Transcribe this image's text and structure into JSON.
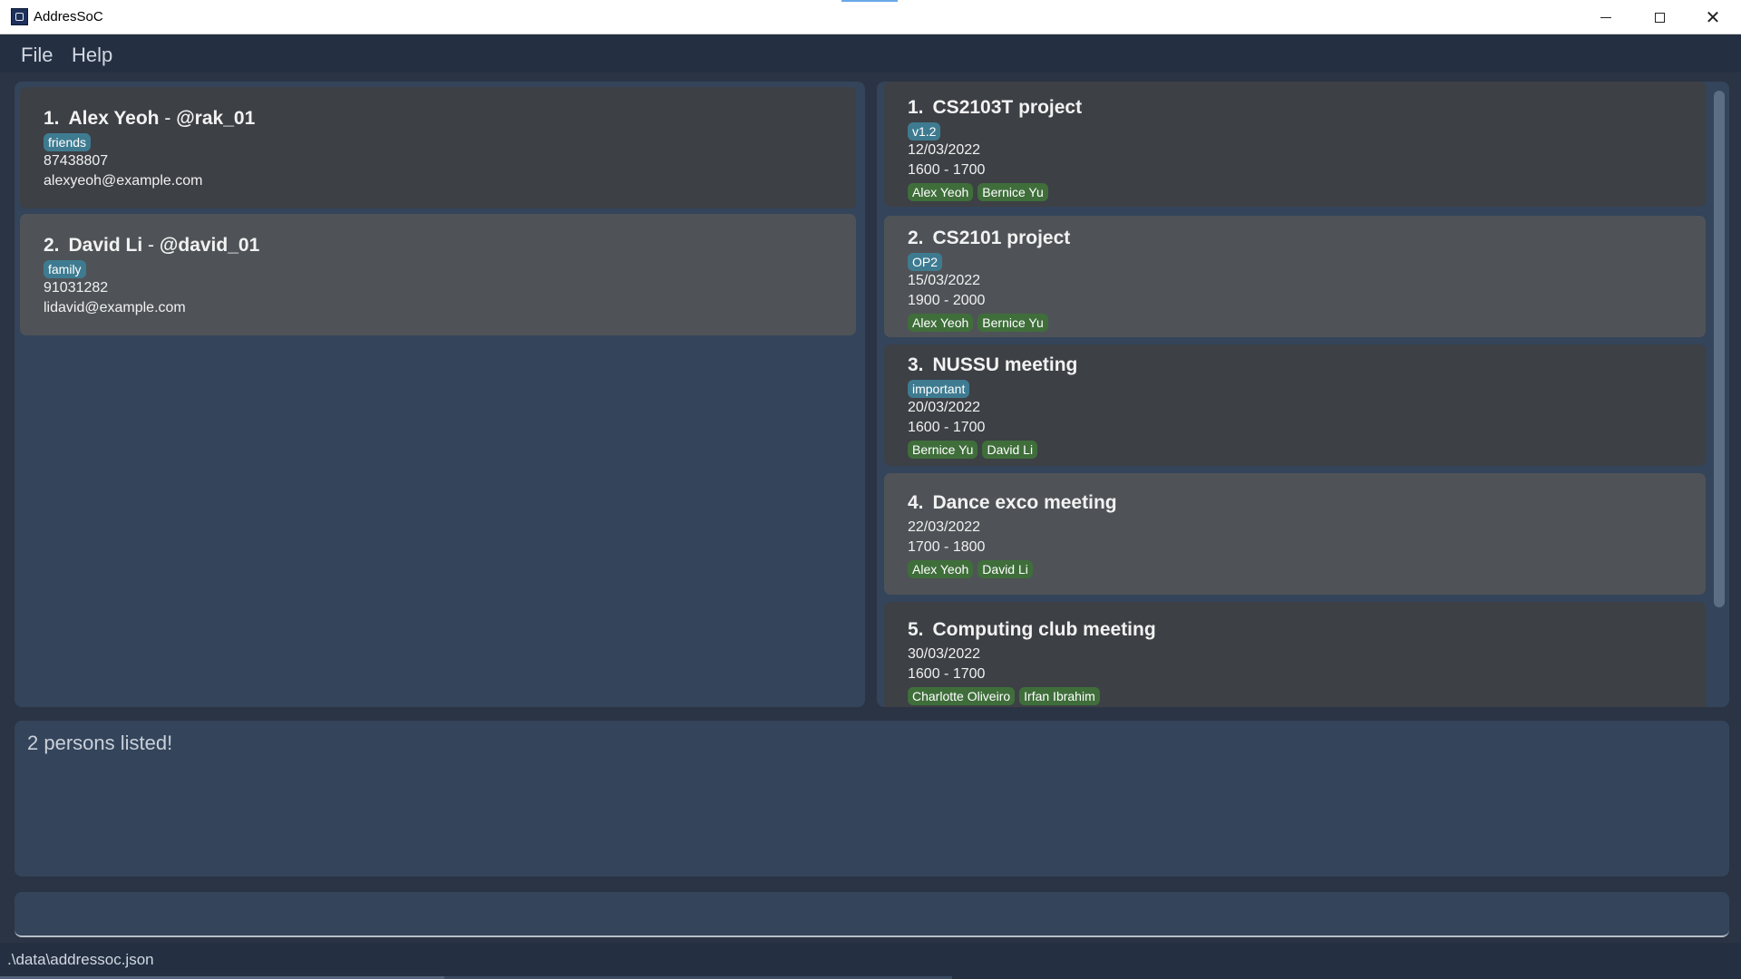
{
  "window": {
    "title": "AddresSoC"
  },
  "menu": {
    "file": "File",
    "help": "Help"
  },
  "persons": [
    {
      "index": "1.",
      "name": "Alex Yeoh",
      "separator": "-",
      "handle": "@rak_01",
      "tags": [
        "friends"
      ],
      "phone": "87438807",
      "email": "alexyeoh@example.com"
    },
    {
      "index": "2.",
      "name": "David Li",
      "separator": "-",
      "handle": "@david_01",
      "tags": [
        "family"
      ],
      "phone": "91031282",
      "email": "lidavid@example.com"
    }
  ],
  "events": [
    {
      "index": "1.",
      "name": "CS2103T project",
      "tags": [
        "v1.2"
      ],
      "date": "12/03/2022",
      "time": "1600 - 1700",
      "participants": [
        "Alex Yeoh",
        "Bernice Yu"
      ]
    },
    {
      "index": "2.",
      "name": "CS2101 project",
      "tags": [
        "OP2"
      ],
      "date": "15/03/2022",
      "time": "1900 - 2000",
      "participants": [
        "Alex Yeoh",
        "Bernice Yu"
      ]
    },
    {
      "index": "3.",
      "name": "NUSSU meeting",
      "tags": [
        "important"
      ],
      "date": "20/03/2022",
      "time": "1600 - 1700",
      "participants": [
        "Bernice Yu",
        "David Li"
      ]
    },
    {
      "index": "4.",
      "name": "Dance exco meeting",
      "tags": [],
      "date": "22/03/2022",
      "time": "1700 - 1800",
      "participants": [
        "Alex Yeoh",
        "David Li"
      ]
    },
    {
      "index": "5.",
      "name": "Computing club meeting",
      "tags": [],
      "date": "30/03/2022",
      "time": "1600 - 1700",
      "participants": [
        "Charlotte Oliveiro",
        "Irfan Ibrahim"
      ]
    }
  ],
  "result": {
    "text": "2 persons listed!"
  },
  "command": {
    "value": "",
    "placeholder": ""
  },
  "status": {
    "path": ".\\data\\addressoc.json"
  },
  "colors": {
    "tag_blue": "#3e7b91",
    "tag_green": "#3f6e3b",
    "card_dark": "#3d4045",
    "card_light": "#4f5357",
    "pane": "#34445a",
    "background": "#2a3444"
  },
  "icons": {
    "app": "app-icon",
    "minimize": "minimize-icon",
    "maximize": "maximize-icon",
    "close": "close-icon"
  }
}
